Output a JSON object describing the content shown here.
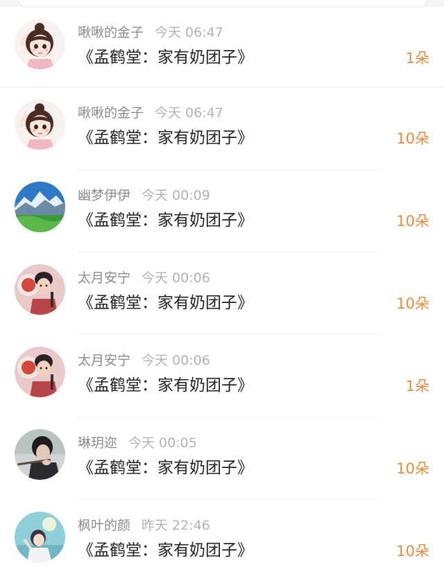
{
  "list": {
    "items": [
      {
        "username": "啾啾的金子",
        "time": "今天 06:47",
        "title": "《孟鹤堂：家有奶团子》",
        "amount": "1朵",
        "avatar": "cartoon-girl-avatar-icon"
      },
      {
        "username": "啾啾的金子",
        "time": "今天 06:47",
        "title": "《孟鹤堂：家有奶团子》",
        "amount": "10朵",
        "avatar": "cartoon-girl-avatar-icon"
      },
      {
        "username": "幽梦伊伊",
        "time": "今天 00:09",
        "title": "《孟鹤堂：家有奶团子》",
        "amount": "10朵",
        "avatar": "mountain-landscape-avatar-icon"
      },
      {
        "username": "太月安宁",
        "time": "今天 00:06",
        "title": "《孟鹤堂：家有奶团子》",
        "amount": "10朵",
        "avatar": "performer-portrait-avatar-icon"
      },
      {
        "username": "太月安宁",
        "time": "今天 00:06",
        "title": "《孟鹤堂：家有奶团子》",
        "amount": "1朵",
        "avatar": "performer-portrait-avatar-icon"
      },
      {
        "username": "琳玥迩",
        "time": "今天 00:05",
        "title": "《孟鹤堂：家有奶团子》",
        "amount": "10朵",
        "avatar": "flute-player-avatar-icon"
      },
      {
        "username": "枫叶的颜",
        "time": "昨天 22:46",
        "title": "《孟鹤堂：家有奶团子》",
        "amount": "10朵",
        "avatar": "anime-girl-sky-avatar-icon"
      }
    ]
  },
  "colors": {
    "accent": "#e68a3e",
    "username": "#8b8b8b",
    "time": "#b2b2b2",
    "title": "#222222",
    "divider": "#f1f1f1"
  }
}
